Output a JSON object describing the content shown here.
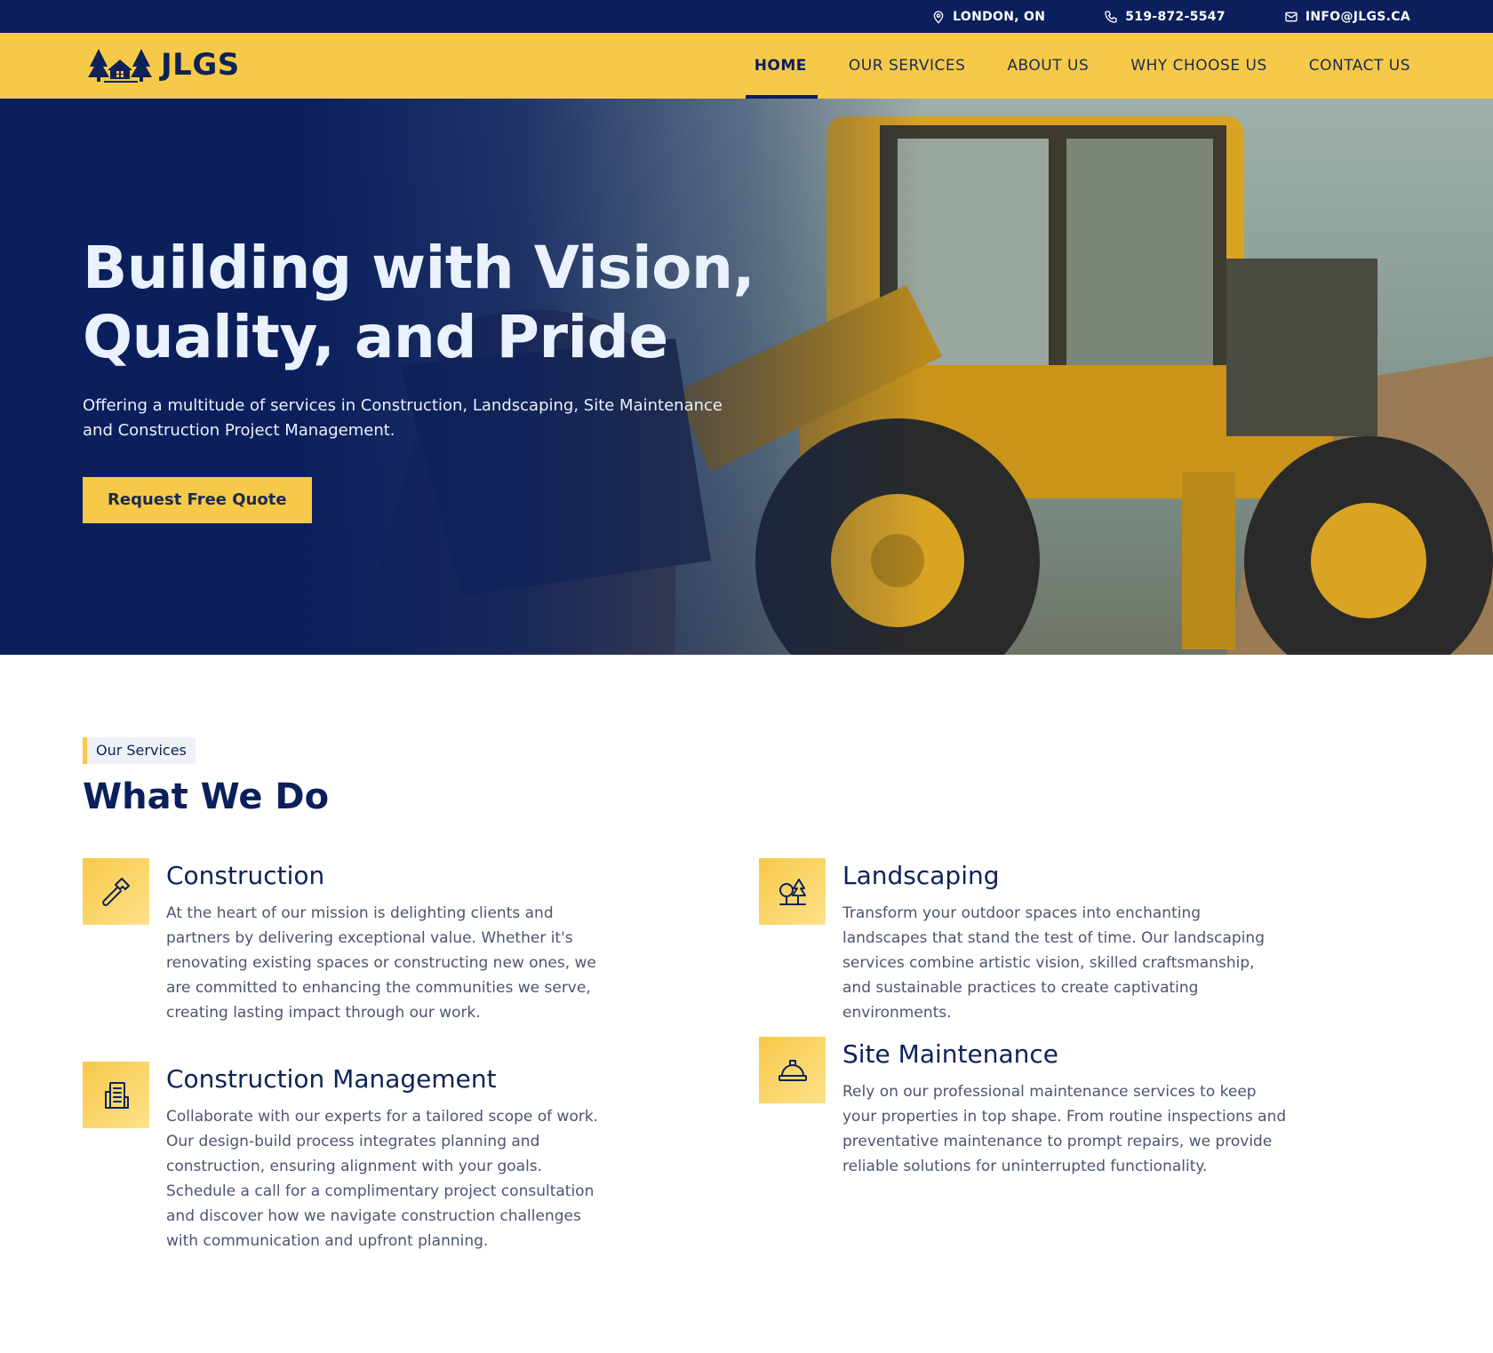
{
  "topbar": {
    "location": "LONDON, ON",
    "phone": "519-872-5547",
    "email": "INFO@JLGS.CA"
  },
  "nav": {
    "logo_text": "JLGS",
    "items": [
      "HOME",
      "OUR SERVICES",
      "ABOUT US",
      "WHY CHOOSE US",
      "CONTACT US"
    ],
    "active": "HOME"
  },
  "hero": {
    "title_line1": "Building with Vision,",
    "title_line2": "Quality, and Pride",
    "subtitle": "Offering a multitude of services in Construction, Landscaping, Site Maintenance and Construction Project Management.",
    "cta": "Request Free Quote"
  },
  "services": {
    "tag": "Our Services",
    "title": "What We Do",
    "items": [
      {
        "title": "Construction",
        "icon": "hammer-icon",
        "text": "At the heart of our mission is delighting clients and partners by delivering exceptional value. Whether it's renovating existing spaces or constructing new ones, we are committed to enhancing the communities we serve, creating lasting impact through our work."
      },
      {
        "title": "Landscaping",
        "icon": "trees-icon",
        "text": "Transform your outdoor spaces into enchanting landscapes that stand the test of time. Our landscaping services combine artistic vision, skilled craftsmanship, and sustainable practices to create captivating environments."
      },
      {
        "title": "Construction Management",
        "icon": "building-icon",
        "text": "Collaborate with our experts for a tailored scope of work. Our design-build process integrates planning and construction, ensuring alignment with your goals. Schedule a call for a complimentary project consultation and discover how we navigate construction challenges with communication and upfront planning."
      },
      {
        "title": "Site Maintenance",
        "icon": "hard-hat-icon",
        "text": "Rely on our professional maintenance services to keep your properties in top shape. From routine inspections and preventative maintenance to prompt repairs, we provide reliable solutions for uninterrupted functionality."
      }
    ]
  },
  "colors": {
    "navy": "#0a1f5c",
    "yellow": "#f7c948"
  }
}
